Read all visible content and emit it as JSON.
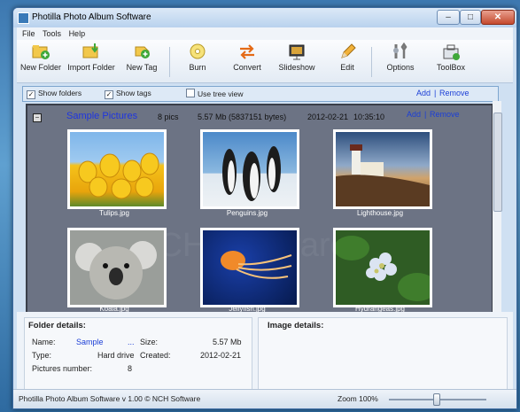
{
  "window": {
    "title": "Photilla Photo Album Software"
  },
  "menu": [
    "File",
    "Tools",
    "Help"
  ],
  "toolbar": {
    "new_folder": "New Folder",
    "import_folder": "Import Folder",
    "new_tag": "New Tag",
    "burn": "Burn",
    "convert": "Convert",
    "slideshow": "Slideshow",
    "edit": "Edit",
    "options": "Options",
    "toolbox": "ToolBox"
  },
  "options_bar": {
    "show_folders": "Show folders",
    "show_tags": "Show tags",
    "tree_view": "Use tree view",
    "add": "Add",
    "separator": "|",
    "remove": "Remove"
  },
  "album": {
    "name": "Sample Pictures",
    "count": "8 pics",
    "size": "5.57 Mb (5837151 bytes)",
    "date": "2012-02-21",
    "time": "10:35:10",
    "add": "Add",
    "separator": "|",
    "remove": "Remove"
  },
  "pictures": [
    {
      "file": "Tulips.jpg"
    },
    {
      "file": "Penguins.jpg"
    },
    {
      "file": "Lighthouse.jpg"
    },
    {
      "file": "Koala.jpg"
    },
    {
      "file": "Jellyfish.jpg"
    },
    {
      "file": "Hydrangeas.jpg"
    }
  ],
  "folder_details": {
    "heading": "Folder details:",
    "name_label": "Name:",
    "name_value": "Sample",
    "name_ellipsis": "...",
    "size_label": "Size:",
    "size_value": "5.57 Mb",
    "type_label": "Type:",
    "type_value": "Hard drive",
    "created_label": "Created:",
    "created_value": "2012-02-21",
    "pictures_label": "Pictures number:",
    "pictures_value": "8"
  },
  "image_details": {
    "heading": "Image details:"
  },
  "status": {
    "text": "Photilla Photo Album Software v 1.00 © NCH Software",
    "zoom": "Zoom 100%"
  }
}
